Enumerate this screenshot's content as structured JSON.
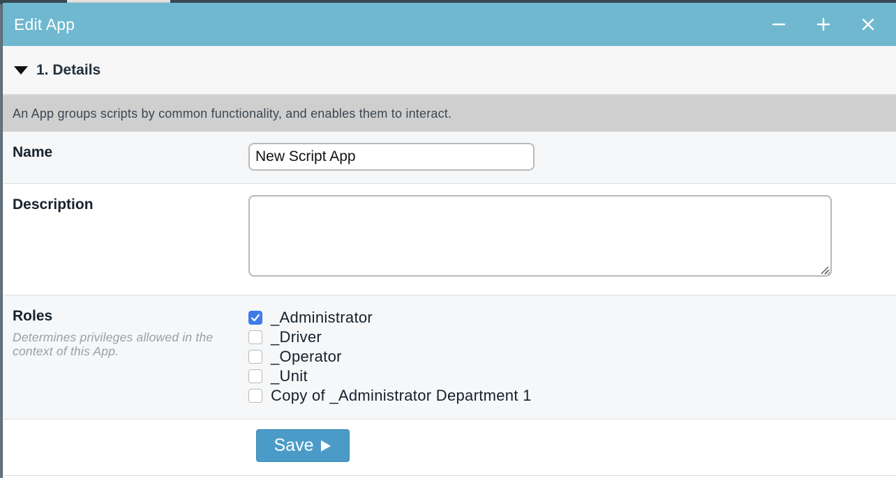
{
  "window": {
    "title": "Edit App",
    "controls": {
      "minimize": "minimize-icon",
      "maximize": "plus-icon",
      "close": "close-icon"
    }
  },
  "section": {
    "title": "1. Details",
    "icon": "caret-down-icon",
    "description": "An App groups scripts by common functionality, and enables them to interact."
  },
  "form": {
    "name": {
      "label": "Name",
      "value": "New Script App"
    },
    "description": {
      "label": "Description",
      "value": ""
    },
    "roles": {
      "label": "Roles",
      "hint": "Determines privileges allowed in the context of this App.",
      "items": [
        {
          "label": "_Administrator",
          "checked": true
        },
        {
          "label": "_Driver",
          "checked": false
        },
        {
          "label": "_Operator",
          "checked": false
        },
        {
          "label": "_Unit",
          "checked": false
        },
        {
          "label": "Copy of _Administrator Department 1",
          "checked": false
        }
      ]
    },
    "save": {
      "label": "Save",
      "icon": "play-arrow-icon"
    }
  },
  "colors": {
    "titlebar": "#6fb8cf",
    "checkbox_checked": "#3d7bea",
    "save_button": "#4b9bc9"
  }
}
